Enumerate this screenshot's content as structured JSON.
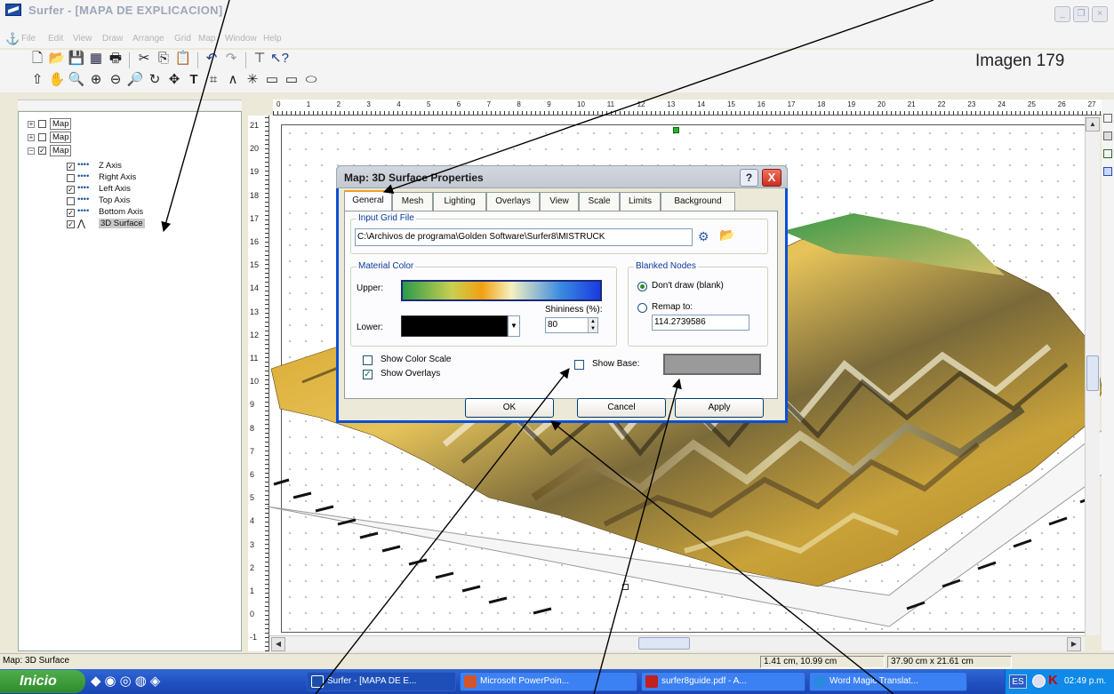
{
  "window": {
    "title": "Surfer - [MAPA DE EXPLICACION]",
    "minimize": "_",
    "restore": "❐",
    "close": "×"
  },
  "menu": [
    "File",
    "Edit",
    "View",
    "Draw",
    "Arrange",
    "Grid",
    "Map",
    "Window",
    "Help"
  ],
  "watermark": "Imagen 179",
  "tree": {
    "items": [
      {
        "label": "Map",
        "checked": false,
        "expander": "+"
      },
      {
        "label": "Map",
        "checked": false,
        "expander": "+"
      },
      {
        "label": "Map",
        "checked": true,
        "expander": "−"
      },
      {
        "label": "Z Axis",
        "checked": true
      },
      {
        "label": "Right Axis",
        "checked": false
      },
      {
        "label": "Left Axis",
        "checked": true
      },
      {
        "label": "Top Axis",
        "checked": false
      },
      {
        "label": "Bottom Axis",
        "checked": true
      },
      {
        "label": "3D Surface",
        "checked": true
      }
    ]
  },
  "ruler": {
    "h": [
      "0",
      "1",
      "2",
      "3",
      "4",
      "5",
      "6",
      "7",
      "8",
      "9",
      "10",
      "11",
      "12",
      "13",
      "14",
      "15",
      "16",
      "17",
      "18",
      "19",
      "20",
      "21",
      "22",
      "23",
      "24",
      "25",
      "26",
      "27"
    ],
    "v": [
      "21",
      "20",
      "19",
      "18",
      "17",
      "16",
      "15",
      "14",
      "13",
      "12",
      "11",
      "10",
      "9",
      "8",
      "7",
      "6",
      "5",
      "4",
      "3",
      "2",
      "1",
      "0",
      "-1"
    ]
  },
  "dialog": {
    "title": "Map: 3D Surface Properties",
    "help": "?",
    "close": "X",
    "tabs": [
      "General",
      "Mesh",
      "Lighting",
      "Overlays",
      "View",
      "Scale",
      "Limits",
      "Background"
    ],
    "input_grid_group": "Input Grid File",
    "input_grid_path": "C:\\Archivos de programa\\Golden Software\\Surfer8\\MISTRUCK",
    "material_group": "Material Color",
    "upper_label": "Upper:",
    "lower_label": "Lower:",
    "shininess_label": "Shininess (%):",
    "shininess_value": "80",
    "blanked_group": "Blanked Nodes",
    "dont_draw": "Don't draw (blank)",
    "remap": "Remap to:",
    "remap_value": "114.2739586",
    "show_color_scale": "Show Color Scale",
    "show_overlays": "Show Overlays",
    "show_base": "Show Base:",
    "ok": "OK",
    "cancel": "Cancel",
    "apply": "Apply"
  },
  "status": {
    "left": "Map: 3D Surface",
    "coords": "1.41 cm, 10.99 cm",
    "size": "37.90 cm x 21.61 cm"
  },
  "taskbar": {
    "start": "Inicio",
    "tasks": [
      "Surfer - [MAPA DE E...",
      "Microsoft PowerPoin...",
      "surfer8guide.pdf - A...",
      "Word Magic Translat..."
    ],
    "lang": "ES",
    "clock": "02:49 p.m."
  },
  "colors": {
    "titlebar_dialog": "#0a4fd6",
    "start": "#3f9f3f",
    "taskbar": "#245edb"
  },
  "icons": [
    "app-icon",
    "new-icon",
    "open-icon",
    "save-icon",
    "print-icon",
    "cut-icon",
    "copy-icon",
    "paste-icon",
    "undo-icon",
    "redo-icon",
    "help-pointer-icon",
    "select-arrow-icon",
    "hand-icon",
    "zoom-icon",
    "text-icon",
    "polyline-icon",
    "rectangle-icon",
    "ellipse-icon",
    "folder-open-icon",
    "grid-browse-icon"
  ]
}
